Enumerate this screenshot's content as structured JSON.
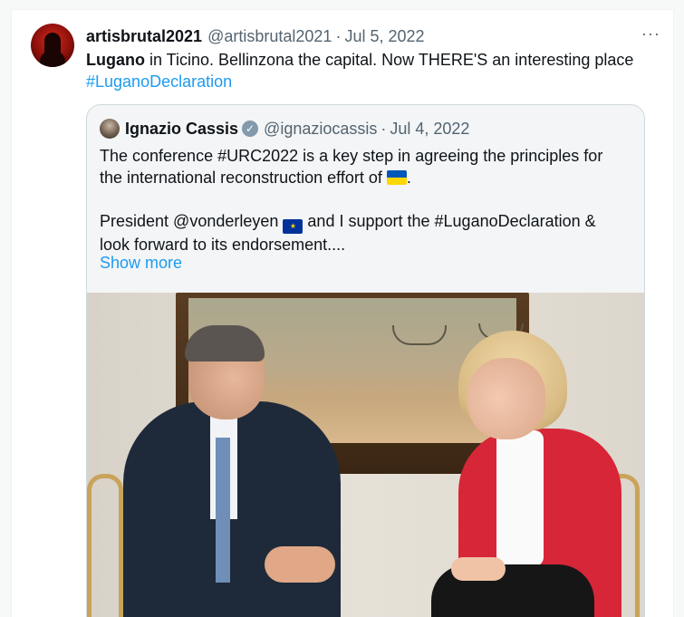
{
  "tweet": {
    "author_name": "artisbrutal2021",
    "author_handle": "@artisbrutal2021",
    "separator": "·",
    "date": "Jul 5, 2022",
    "more_label": "···",
    "text_bold": "Lugano",
    "text_rest": " in Ticino.  Bellinzona the capital. Now THERE'S an interesting place",
    "hashtag": "#LuganoDeclaration"
  },
  "quoted": {
    "author_name": "Ignazio Cassis",
    "verified_mark": "✓",
    "author_handle": "@ignaziocassis",
    "separator": "·",
    "date": "Jul 4, 2022",
    "line1": "The conference #URC2022 is a key step in agreeing the principles for",
    "line2": "the international reconstruction effort of",
    "line2_end": ".",
    "line3_start": "President @vonderleyen",
    "line3_end": "and I support the #LuganoDeclaration &",
    "line4": "look forward to its endorsement....",
    "show_more": "Show more",
    "flag_ua_colors": [
      "#0057b7",
      "#ffd700"
    ],
    "flag_eu_symbol": "★"
  },
  "colors": {
    "link": "#1d9bf0",
    "muted": "#536471"
  }
}
